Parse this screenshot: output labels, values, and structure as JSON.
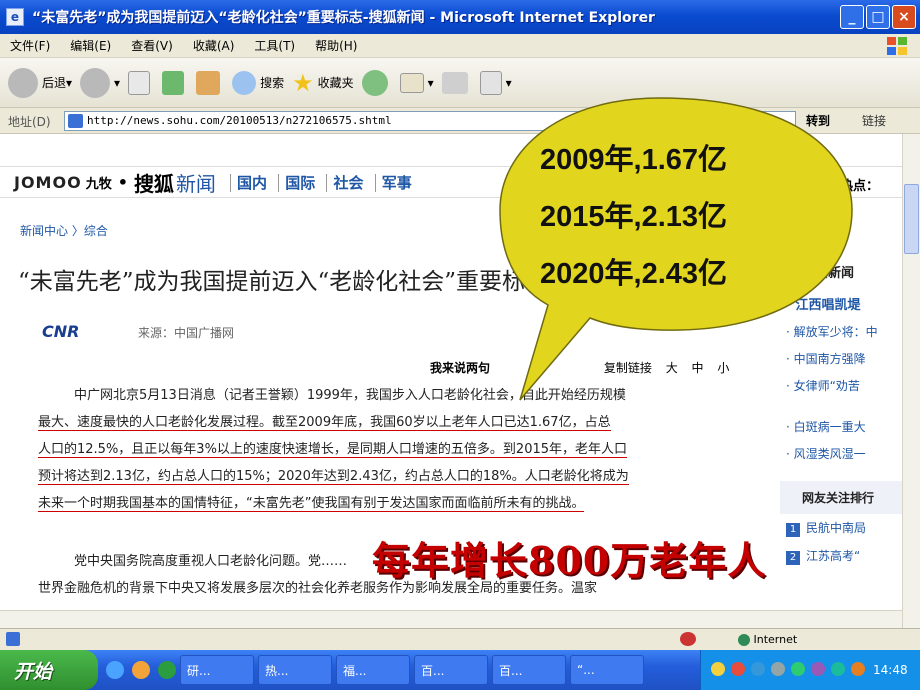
{
  "window": {
    "title": "“未富先老”成为我国提前迈入“老龄化社会”重要标志-搜狐新闻 - Microsoft Internet Explorer",
    "min": "_",
    "max": "□",
    "close": "×"
  },
  "menu": [
    "文件(F)",
    "编辑(E)",
    "查看(V)",
    "收藏(A)",
    "工具(T)",
    "帮助(H)"
  ],
  "toolbar": {
    "back": "后退",
    "search": "搜索",
    "favorites": "收藏夹"
  },
  "address": {
    "label": "地址(D)",
    "url": "http://news.sohu.com/20100513/n272106575.shtml",
    "go": "转到",
    "links": "链接"
  },
  "page": {
    "brand": "JOMOO",
    "brand_cn": "九牧",
    "site": "搜狐",
    "site_news": "新闻",
    "nav": [
      "国内",
      "国际",
      "社会",
      "军事"
    ],
    "nav_right": "热点：",
    "breadcrumb": "新闻中心 〉综合",
    "headline": "“未富先老”成为我国提前迈入“老龄化社会”重要标志",
    "cnr": "CNR",
    "source": "来源：中国广播网",
    "tools": [
      "我来说两句",
      "复制链接",
      "大",
      "中",
      "小"
    ],
    "para1_lines": [
      "中广网北京5月13日消息（记者王誉颖）1999年，我国步入人口老龄化社会，自此开始经历规模",
      "最大、速度最快的人口老龄化发展过程。截至2009年底，我国60岁以上老年人口已达1.67亿，占总",
      "人口的12.5%，且正以每年3%以上的速度快速增长，是同期人口增速的五倍多。到2015年，老年人口",
      "预计将达到2.13亿，约占总人口的15%；2020年达到2.43亿，约占总人口的18%。人口老龄化将成为",
      "未来一个时期我国基本的国情特征，“未富先老”使我国有别于发达国家而面临前所未有的挑战。"
    ],
    "para2_lines": [
      "党中央国务院高度重视人口老龄化问题。党……",
      "世界金融危机的背景下中央又将发展多层次的社会化养老服务作为影响发展全局的重要任务。温家"
    ],
    "sidebar": {
      "heading": "重要新闻",
      "items": [
        "江西唱凯堤",
        "解放军少将：中",
        "中国南方强降",
        "女律师“劝苦",
        "白斑病一重大",
        "风湿类风湿一"
      ],
      "rank_heading": "网友关注排行",
      "rank_items": [
        {
          "n": "1",
          "t": "民航中南局"
        },
        {
          "n": "2",
          "t": "江苏高考“"
        }
      ]
    }
  },
  "bubble": [
    "2009年,1.67亿",
    "2015年,2.13亿",
    "2020年,2.43亿"
  ],
  "overlay_caption": "每年增长800万老年人",
  "status": {
    "zone": "Internet"
  },
  "taskbar": {
    "start": "开始",
    "tasks": [
      "研...",
      "热...",
      "福...",
      "百...",
      "百...",
      "“..."
    ],
    "clock": "14:48"
  },
  "colors": {
    "title_blue": "#0a4bd0",
    "bubble_yellow": "#e2d51e",
    "caption_red": "#c40000",
    "underline_red": "#cc0000"
  }
}
